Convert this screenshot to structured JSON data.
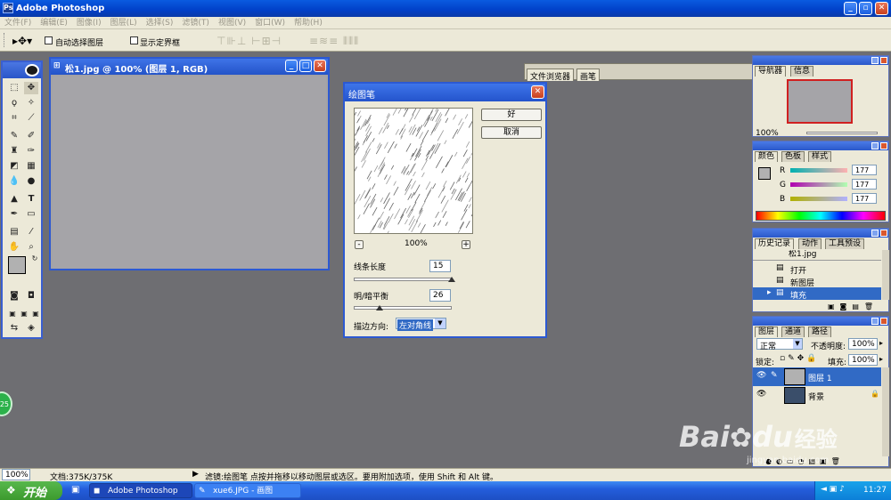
{
  "app": {
    "title": "Adobe Photoshop"
  },
  "menu": [
    "文件(F)",
    "编辑(E)",
    "图像(I)",
    "图层(L)",
    "选择(S)",
    "滤镜(T)",
    "视图(V)",
    "窗口(W)",
    "帮助(H)"
  ],
  "options": {
    "auto_select": "自动选择图层",
    "show_bounds": "显示定界框",
    "file_browser": "文件浏览器",
    "brushes": "画笔"
  },
  "document": {
    "title": "松1.jpg @ 100% (图层 1, RGB)"
  },
  "dialog": {
    "title": "绘图笔",
    "ok": "好",
    "cancel": "取消",
    "zoom": "100%",
    "minus": "-",
    "plus": "+",
    "stroke_length_label": "线条长度",
    "stroke_length": "15",
    "stroke_length_level": 1.0,
    "balance_label": "明/暗平衡",
    "balance": "26",
    "balance_level": 0.26,
    "direction_label": "描边方向:",
    "direction": "左对角线"
  },
  "navigator": {
    "tabs": [
      "导航器",
      "信息"
    ],
    "zoom": "100%"
  },
  "color": {
    "tabs": [
      "颜色",
      "色板",
      "样式"
    ],
    "channels": [
      {
        "label": "R",
        "value": "177"
      },
      {
        "label": "G",
        "value": "177"
      },
      {
        "label": "B",
        "value": "177"
      }
    ]
  },
  "history": {
    "tabs": [
      "历史记录",
      "动作",
      "工具预设"
    ],
    "items": [
      "松1.jpg",
      "打开",
      "新图层",
      "填充"
    ]
  },
  "layers": {
    "tabs": [
      "图层",
      "通道",
      "路径"
    ],
    "blend": "正常",
    "opacity_label": "不透明度:",
    "opacity": "100%",
    "lock_label": "锁定:",
    "fill_label": "填充:",
    "fill": "100%",
    "items": [
      "图层 1",
      "背景"
    ]
  },
  "status": {
    "zoom": "100%",
    "doc": "文档:375K/375K",
    "hint": "滤镜:绘图笔  点按并拖移以移动图层或选区。要用附加选项，使用 Shift 和 Alt 键。"
  },
  "taskbar": {
    "start": "开始",
    "tasks": [
      "Adobe Photoshop",
      "xue6.JPG - 画图"
    ],
    "time": "11:27"
  },
  "badge": "25",
  "watermark": {
    "brand_a": "Bai",
    "brand_b": "du",
    "brand_cn": "经验",
    "url": "jingyan.baidu.com"
  },
  "colors": {
    "titlebar": "#0a5be0",
    "workspace": "#6e6e72",
    "panel": "#ece9d8",
    "canvas_gray": "#a5a4a8",
    "selection": "#316ac5"
  }
}
